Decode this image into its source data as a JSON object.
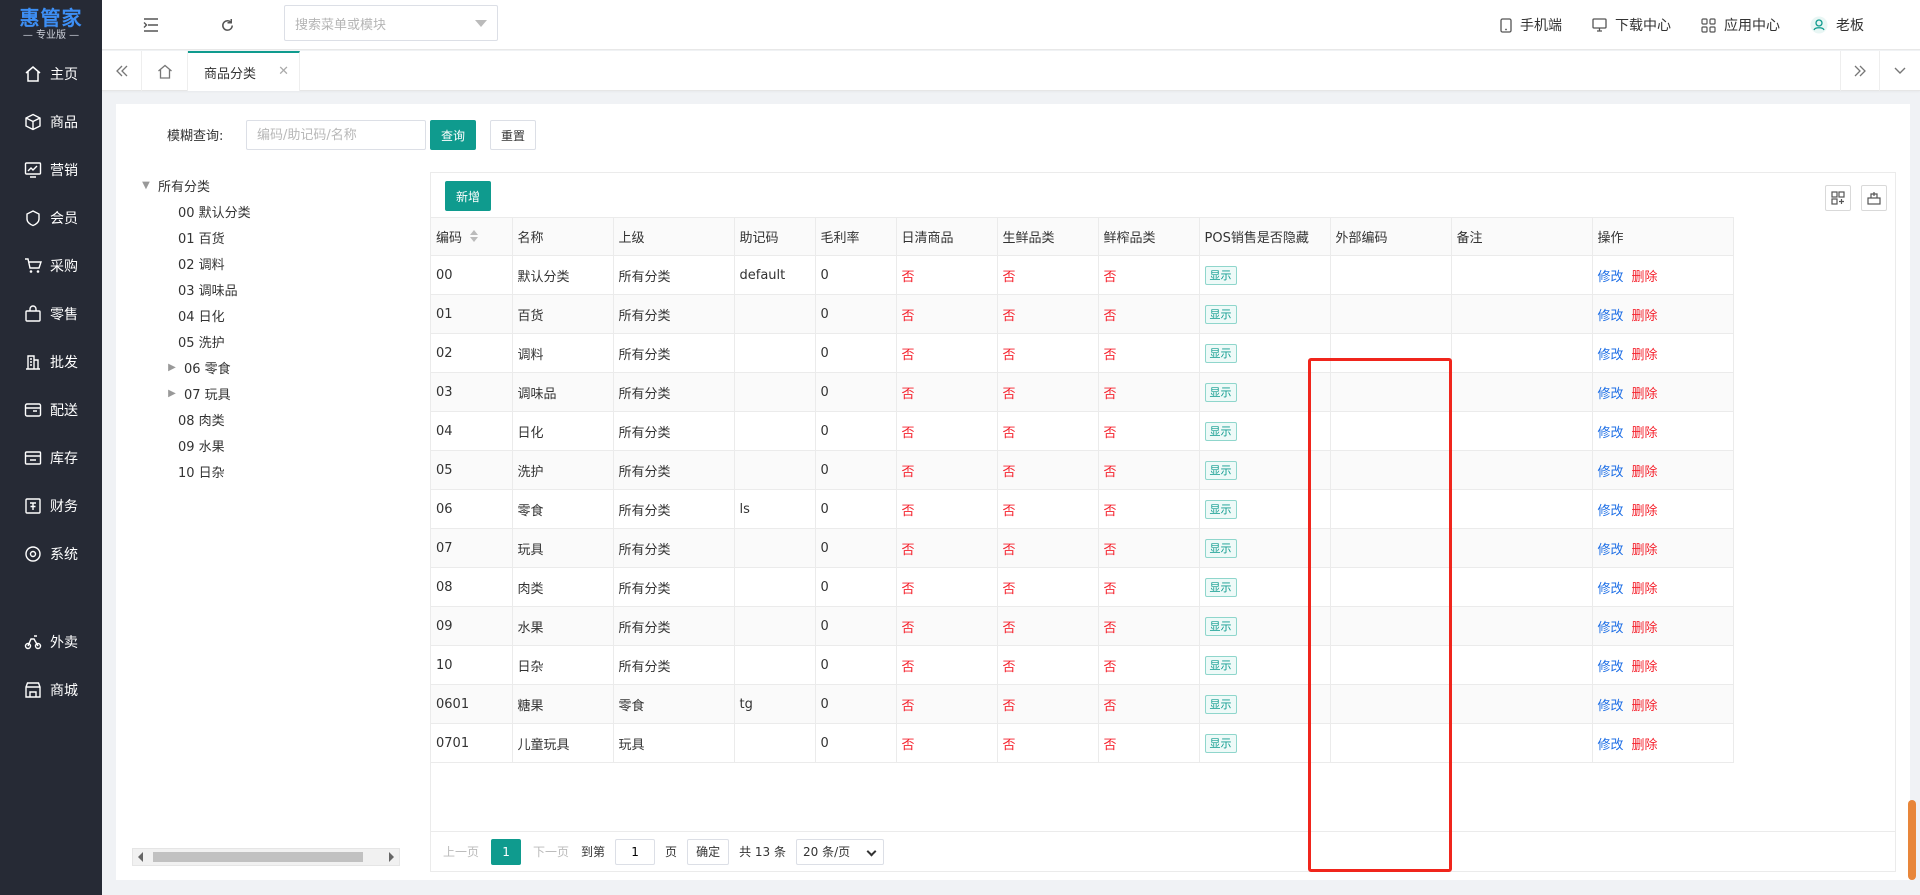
{
  "logo": {
    "main": "惠管家",
    "sub": "专业版"
  },
  "sidebar": {
    "items": [
      {
        "label": "主页",
        "icon": "home-icon"
      },
      {
        "label": "商品",
        "icon": "cube-icon"
      },
      {
        "label": "营销",
        "icon": "marketing-icon"
      },
      {
        "label": "会员",
        "icon": "member-icon"
      },
      {
        "label": "采购",
        "icon": "cart-icon"
      },
      {
        "label": "零售",
        "icon": "bag-icon"
      },
      {
        "label": "批发",
        "icon": "building-icon"
      },
      {
        "label": "配送",
        "icon": "delivery-icon"
      },
      {
        "label": "库存",
        "icon": "inventory-icon"
      },
      {
        "label": "财务",
        "icon": "finance-icon"
      },
      {
        "label": "系统",
        "icon": "settings-icon"
      }
    ],
    "extra": [
      {
        "label": "外卖",
        "icon": "takeout-icon"
      },
      {
        "label": "商城",
        "icon": "store-icon"
      }
    ]
  },
  "topbar": {
    "search_placeholder": "搜索菜单或模块",
    "links": {
      "mobile": "手机端",
      "download": "下载中心",
      "apps": "应用中心",
      "user": "老板"
    }
  },
  "tabs": {
    "active": "商品分类"
  },
  "filter": {
    "label": "模糊查询:",
    "placeholder": "编码/助记码/名称",
    "query_button": "查询",
    "reset_button": "重置"
  },
  "tree": {
    "root": "所有分类",
    "nodes": [
      {
        "label": "00 默认分类",
        "expandable": false
      },
      {
        "label": "01 百货",
        "expandable": false
      },
      {
        "label": "02 调料",
        "expandable": false
      },
      {
        "label": "03 调味品",
        "expandable": false
      },
      {
        "label": "04 日化",
        "expandable": false
      },
      {
        "label": "05 洗护",
        "expandable": false
      },
      {
        "label": "06 零食",
        "expandable": true
      },
      {
        "label": "07 玩具",
        "expandable": true
      },
      {
        "label": "08 肉类",
        "expandable": false
      },
      {
        "label": "09 水果",
        "expandable": false
      },
      {
        "label": "10 日杂",
        "expandable": false
      }
    ]
  },
  "grid": {
    "add_button": "新增",
    "columns": [
      "编码",
      "名称",
      "上级",
      "助记码",
      "毛利率",
      "日清商品",
      "生鲜品类",
      "鲜榨品类",
      "POS销售是否隐藏",
      "外部编码",
      "备注",
      "操作"
    ],
    "rows": [
      {
        "code": "00",
        "name": "默认分类",
        "parent": "所有分类",
        "mnemonic": "default",
        "margin": "0",
        "daily": "否",
        "fresh": "否",
        "juice": "否",
        "pos": "显示",
        "ext": "",
        "note": ""
      },
      {
        "code": "01",
        "name": "百货",
        "parent": "所有分类",
        "mnemonic": "",
        "margin": "0",
        "daily": "否",
        "fresh": "否",
        "juice": "否",
        "pos": "显示",
        "ext": "",
        "note": ""
      },
      {
        "code": "02",
        "name": "调料",
        "parent": "所有分类",
        "mnemonic": "",
        "margin": "0",
        "daily": "否",
        "fresh": "否",
        "juice": "否",
        "pos": "显示",
        "ext": "",
        "note": ""
      },
      {
        "code": "03",
        "name": "调味品",
        "parent": "所有分类",
        "mnemonic": "",
        "margin": "0",
        "daily": "否",
        "fresh": "否",
        "juice": "否",
        "pos": "显示",
        "ext": "",
        "note": ""
      },
      {
        "code": "04",
        "name": "日化",
        "parent": "所有分类",
        "mnemonic": "",
        "margin": "0",
        "daily": "否",
        "fresh": "否",
        "juice": "否",
        "pos": "显示",
        "ext": "",
        "note": ""
      },
      {
        "code": "05",
        "name": "洗护",
        "parent": "所有分类",
        "mnemonic": "",
        "margin": "0",
        "daily": "否",
        "fresh": "否",
        "juice": "否",
        "pos": "显示",
        "ext": "",
        "note": ""
      },
      {
        "code": "06",
        "name": "零食",
        "parent": "所有分类",
        "mnemonic": "ls",
        "margin": "0",
        "daily": "否",
        "fresh": "否",
        "juice": "否",
        "pos": "显示",
        "ext": "",
        "note": ""
      },
      {
        "code": "07",
        "name": "玩具",
        "parent": "所有分类",
        "mnemonic": "",
        "margin": "0",
        "daily": "否",
        "fresh": "否",
        "juice": "否",
        "pos": "显示",
        "ext": "",
        "note": ""
      },
      {
        "code": "08",
        "name": "肉类",
        "parent": "所有分类",
        "mnemonic": "",
        "margin": "0",
        "daily": "否",
        "fresh": "否",
        "juice": "否",
        "pos": "显示",
        "ext": "",
        "note": ""
      },
      {
        "code": "09",
        "name": "水果",
        "parent": "所有分类",
        "mnemonic": "",
        "margin": "0",
        "daily": "否",
        "fresh": "否",
        "juice": "否",
        "pos": "显示",
        "ext": "",
        "note": ""
      },
      {
        "code": "10",
        "name": "日杂",
        "parent": "所有分类",
        "mnemonic": "",
        "margin": "0",
        "daily": "否",
        "fresh": "否",
        "juice": "否",
        "pos": "显示",
        "ext": "",
        "note": ""
      },
      {
        "code": "0601",
        "name": "糖果",
        "parent": "零食",
        "mnemonic": "tg",
        "margin": "0",
        "daily": "否",
        "fresh": "否",
        "juice": "否",
        "pos": "显示",
        "ext": "",
        "note": ""
      },
      {
        "code": "0701",
        "name": "儿童玩具",
        "parent": "玩具",
        "mnemonic": "",
        "margin": "0",
        "daily": "否",
        "fresh": "否",
        "juice": "否",
        "pos": "显示",
        "ext": "",
        "note": ""
      }
    ],
    "edit_label": "修改",
    "delete_label": "删除"
  },
  "pager": {
    "prev": "上一页",
    "current": "1",
    "next": "下一页",
    "goto_label": "到第",
    "goto_value": "1",
    "page_unit": "页",
    "confirm": "确定",
    "total": "共 13 条",
    "page_size": "20 条/页"
  },
  "colors": {
    "primary": "#0f9b8e",
    "sidebar_bg": "#262a35",
    "danger": "#f5222d",
    "link": "#1e6fe6",
    "highlight_box": "#f0251c"
  }
}
